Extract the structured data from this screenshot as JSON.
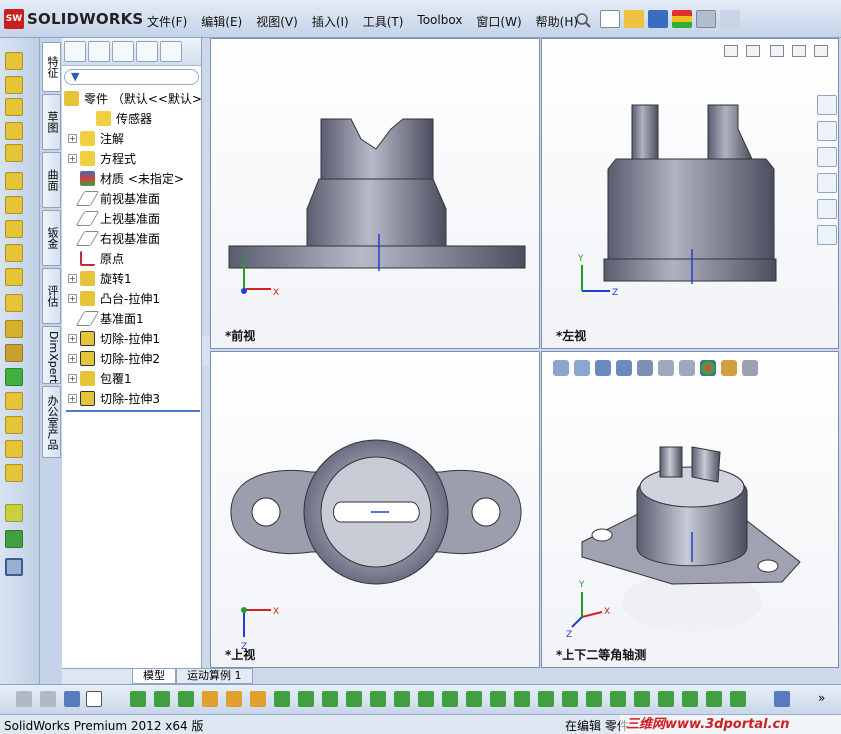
{
  "app": {
    "logo": "SOLIDWORKS",
    "logo_mark": "SW"
  },
  "menu": [
    "文件(F)",
    "编辑(E)",
    "视图(V)",
    "插入(I)",
    "工具(T)",
    "Toolbox",
    "窗口(W)",
    "帮助(H)"
  ],
  "vertical_tabs": [
    "特征",
    "草图",
    "曲面",
    "钣金",
    "评估",
    "DimXpert",
    "办公室产品"
  ],
  "feature_tree": {
    "root": "零件 （默认<<默认>",
    "items": [
      "传感器",
      "注解",
      "方程式",
      "材质 <未指定>",
      "前视基准面",
      "上视基准面",
      "右视基准面",
      "原点",
      "旋转1",
      "凸台-拉伸1",
      "基准面1",
      "切除-拉伸1",
      "切除-拉伸2",
      "包覆1",
      "切除-拉伸3"
    ]
  },
  "bottom_tabs": [
    "模型",
    "运动算例 1"
  ],
  "viewports": {
    "front": "*前视",
    "left": "*左视",
    "top": "*上视",
    "iso": "*上下二等角轴测"
  },
  "axes": {
    "x": "X",
    "y": "Y",
    "z": "Z"
  },
  "status": {
    "left": "SolidWorks Premium 2012 x64 版",
    "right": "在编辑 零件"
  },
  "watermark": "三维网www.3dportal.cn",
  "colors": {
    "accent": "#4a7ac8",
    "model": "#8a8c9c",
    "axis_red": "#d42020",
    "axis_green": "#20a020",
    "axis_blue": "#2040d0"
  }
}
